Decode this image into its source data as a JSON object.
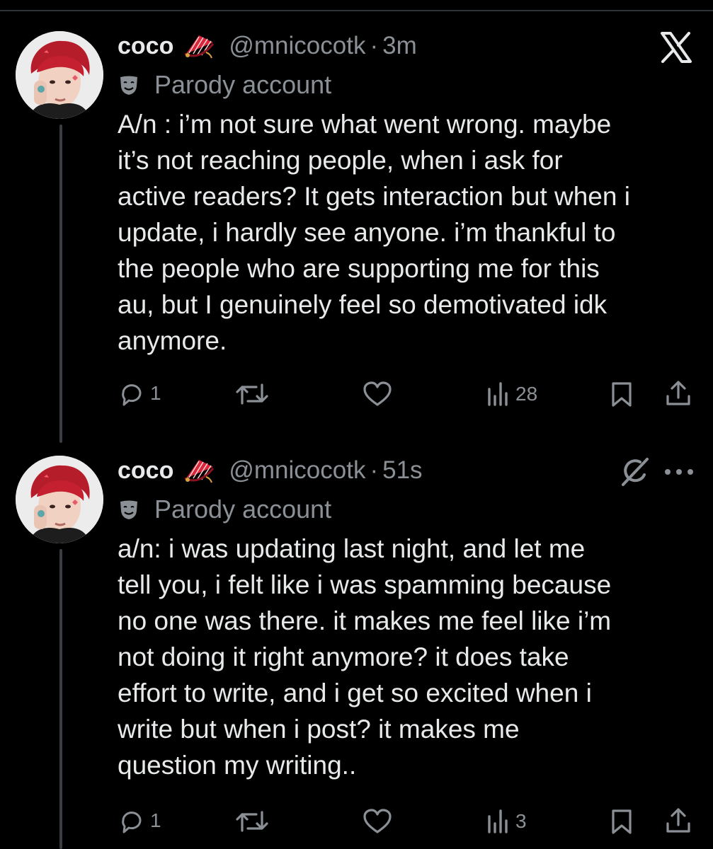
{
  "tweets": [
    {
      "display_name": "coco",
      "handle": "@mnicocotk",
      "separator": "·",
      "time": "3m",
      "parody_label": "Parody account",
      "avatar_icon": "avatar-red-hair-person",
      "top_right_icon": "x-logo-icon",
      "body_lines": [
        "A/n : i’m not sure what went wrong. maybe",
        "it’s not reaching people, when i ask for",
        "active readers? It gets interaction but when i",
        "update, i hardly see anyone. i’m thankful to",
        "the people who are supporting me for this",
        "au, but I genuinely feel so demotivated idk",
        "anymore."
      ],
      "reply_count": "1",
      "repost_count": "",
      "like_count": "",
      "view_count": "28"
    },
    {
      "display_name": "coco",
      "handle": "@mnicocotk",
      "separator": "·",
      "time": "51s",
      "parody_label": "Parody account",
      "avatar_icon": "avatar-red-hair-person",
      "top_right_icon": "grok-icon",
      "more_icon": "more-icon",
      "body_lines": [
        "a/n: i was updating last night, and let me",
        "tell you, i felt like i was spamming because",
        "no one was there. it makes me feel like i’m",
        "not doing it right anymore? it does take",
        "effort to write, and i get so excited when i",
        "write but when i post? it makes me",
        "question my writing.."
      ],
      "reply_count": "1",
      "repost_count": "",
      "like_count": "",
      "view_count": "3"
    }
  ],
  "colors": {
    "background": "#000000",
    "text": "#e7e9ea",
    "muted": "#8b9096",
    "thread_line": "#3a3d41",
    "fan_red": "#d9263a"
  }
}
